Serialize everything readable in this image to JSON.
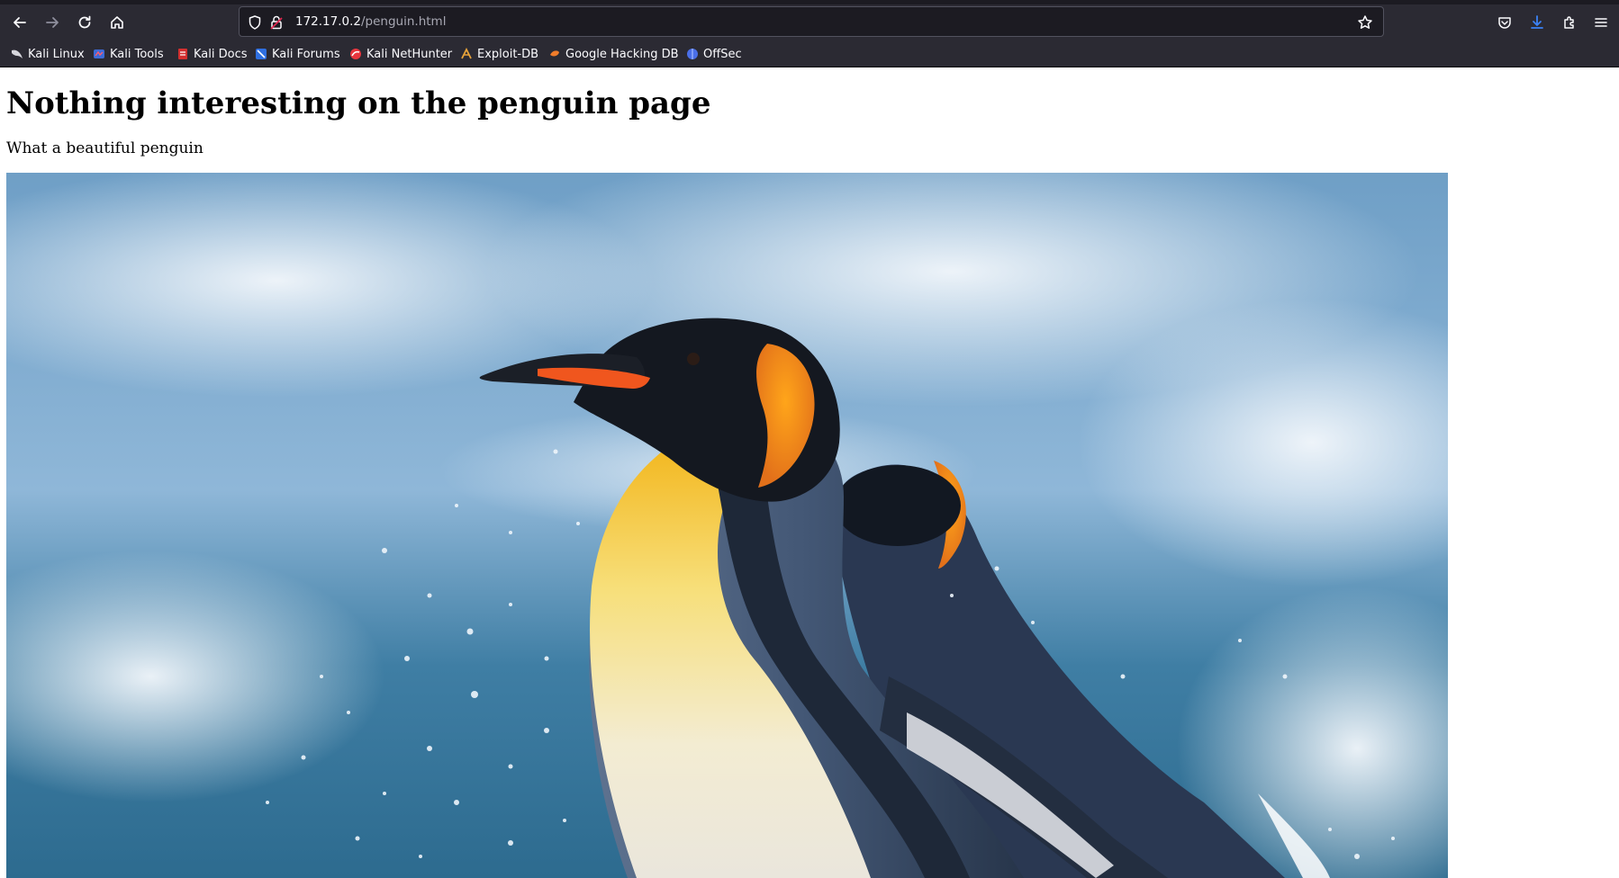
{
  "browser": {
    "url_host": "172.17.0.2",
    "url_path": "/penguin.html",
    "bookmarks": [
      {
        "label": "Kali Linux",
        "icon": "kali-dragon-icon"
      },
      {
        "label": "Kali Tools",
        "icon": "kali-tools-icon"
      },
      {
        "label": "Kali Docs",
        "icon": "kali-docs-icon"
      },
      {
        "label": "Kali Forums",
        "icon": "kali-forums-icon"
      },
      {
        "label": "Kali NetHunter",
        "icon": "kali-nethunter-icon"
      },
      {
        "label": "Exploit-DB",
        "icon": "exploit-db-icon"
      },
      {
        "label": "Google Hacking DB",
        "icon": "ghdb-icon"
      },
      {
        "label": "OffSec",
        "icon": "offsec-icon"
      }
    ],
    "accent_color": "#0060df"
  },
  "page": {
    "heading": "Nothing interesting on the penguin page",
    "paragraph": "What a beautiful penguin",
    "image_subject": "king-penguins-photo"
  }
}
